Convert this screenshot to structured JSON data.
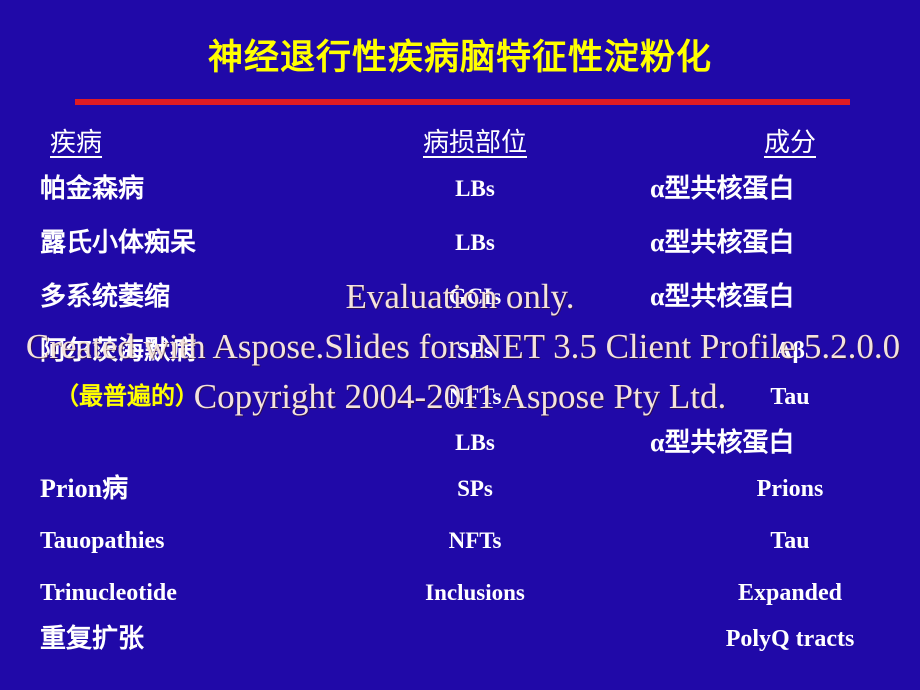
{
  "slide": {
    "title": "神经退行性疾病脑特征性淀粉化",
    "background_color": "#2009a8",
    "title_color": "#ffff00",
    "rule_color": "#e01b22",
    "text_color": "#ffffff",
    "accent_color": "#ffff00"
  },
  "table": {
    "headers": {
      "disease": "疾病",
      "lesion_site": "病损部位",
      "component": "成分"
    },
    "rows": [
      {
        "disease": "帕金森病",
        "site": "LBs",
        "component": "α型共核蛋白"
      },
      {
        "disease": "露氏小体痴呆",
        "site": "LBs",
        "component": "α型共核蛋白"
      },
      {
        "disease": "多系统萎缩",
        "site": "GCIs",
        "component": "α型共核蛋白"
      },
      {
        "disease": "阿尔茨海默病",
        "site": "SPs",
        "component": "Aβ"
      },
      {
        "disease": "（最普遍的）",
        "site": "NFTs",
        "component": "Tau"
      },
      {
        "disease": "",
        "site": "LBs",
        "component": "α型共核蛋白"
      },
      {
        "disease": "Prion病",
        "site": "SPs",
        "component": "Prions"
      },
      {
        "disease": "Tauopathies",
        "site": "NFTs",
        "component": "Tau"
      },
      {
        "disease": "Trinucleotide",
        "site": "Inclusions",
        "component": "Expanded"
      },
      {
        "disease": "重复扩张",
        "site": "",
        "component": "PolyQ tracts"
      }
    ]
  },
  "watermark": {
    "line1": "Evaluation only.",
    "line2": "Created with Aspose.Slides for .NET 3.5 Client Profile 5.2.0.0",
    "line3": "Copyright 2004-2011 Aspose Pty Ltd.",
    "color": "#f4e3dc"
  }
}
